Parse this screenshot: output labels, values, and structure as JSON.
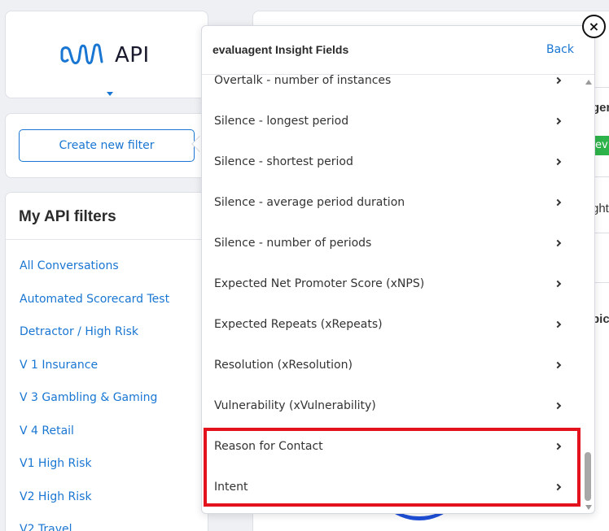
{
  "logo": {
    "text": "API"
  },
  "create_filter": {
    "label": "Create new filter"
  },
  "my_filters": {
    "title": "My API filters",
    "items": [
      "All Conversations",
      "Automated Scorecard Test",
      "Detractor / High Risk",
      "V 1 Insurance",
      "V 3 Gambling & Gaming",
      "V 4 Retail",
      "V1 High Risk",
      "V2 High Risk",
      "V2 Travel"
    ]
  },
  "background_fragments": {
    "f1": "ger",
    "pill": "ev",
    "f2": "ght",
    "f3": "pic"
  },
  "popover": {
    "title": "evaluagent Insight Fields",
    "back_label": "Back",
    "items": [
      "Overtalk - number of instances",
      "Silence - longest period",
      "Silence - shortest period",
      "Silence - average period duration",
      "Silence - number of periods",
      "Expected Net Promoter Score (xNPS)",
      "Expected Repeats (xRepeats)",
      "Resolution (xResolution)",
      "Vulnerability (xVulnerability)",
      "Reason for Contact",
      "Intent"
    ]
  },
  "close": {
    "label": "×"
  },
  "colors": {
    "accent": "#1976d2",
    "highlight": "#e3121c",
    "pill": "#2eb34a"
  }
}
